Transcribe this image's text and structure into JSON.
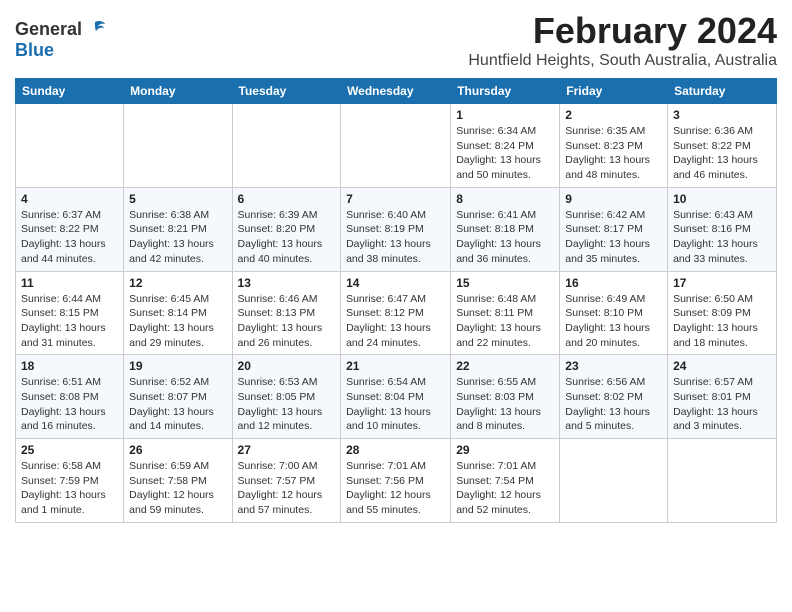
{
  "logo": {
    "general": "General",
    "blue": "Blue"
  },
  "title": {
    "month_year": "February 2024",
    "location": "Huntfield Heights, South Australia, Australia"
  },
  "weekdays": [
    "Sunday",
    "Monday",
    "Tuesday",
    "Wednesday",
    "Thursday",
    "Friday",
    "Saturday"
  ],
  "weeks": [
    [
      {
        "day": "",
        "info": ""
      },
      {
        "day": "",
        "info": ""
      },
      {
        "day": "",
        "info": ""
      },
      {
        "day": "",
        "info": ""
      },
      {
        "day": "1",
        "info": "Sunrise: 6:34 AM\nSunset: 8:24 PM\nDaylight: 13 hours\nand 50 minutes."
      },
      {
        "day": "2",
        "info": "Sunrise: 6:35 AM\nSunset: 8:23 PM\nDaylight: 13 hours\nand 48 minutes."
      },
      {
        "day": "3",
        "info": "Sunrise: 6:36 AM\nSunset: 8:22 PM\nDaylight: 13 hours\nand 46 minutes."
      }
    ],
    [
      {
        "day": "4",
        "info": "Sunrise: 6:37 AM\nSunset: 8:22 PM\nDaylight: 13 hours\nand 44 minutes."
      },
      {
        "day": "5",
        "info": "Sunrise: 6:38 AM\nSunset: 8:21 PM\nDaylight: 13 hours\nand 42 minutes."
      },
      {
        "day": "6",
        "info": "Sunrise: 6:39 AM\nSunset: 8:20 PM\nDaylight: 13 hours\nand 40 minutes."
      },
      {
        "day": "7",
        "info": "Sunrise: 6:40 AM\nSunset: 8:19 PM\nDaylight: 13 hours\nand 38 minutes."
      },
      {
        "day": "8",
        "info": "Sunrise: 6:41 AM\nSunset: 8:18 PM\nDaylight: 13 hours\nand 36 minutes."
      },
      {
        "day": "9",
        "info": "Sunrise: 6:42 AM\nSunset: 8:17 PM\nDaylight: 13 hours\nand 35 minutes."
      },
      {
        "day": "10",
        "info": "Sunrise: 6:43 AM\nSunset: 8:16 PM\nDaylight: 13 hours\nand 33 minutes."
      }
    ],
    [
      {
        "day": "11",
        "info": "Sunrise: 6:44 AM\nSunset: 8:15 PM\nDaylight: 13 hours\nand 31 minutes."
      },
      {
        "day": "12",
        "info": "Sunrise: 6:45 AM\nSunset: 8:14 PM\nDaylight: 13 hours\nand 29 minutes."
      },
      {
        "day": "13",
        "info": "Sunrise: 6:46 AM\nSunset: 8:13 PM\nDaylight: 13 hours\nand 26 minutes."
      },
      {
        "day": "14",
        "info": "Sunrise: 6:47 AM\nSunset: 8:12 PM\nDaylight: 13 hours\nand 24 minutes."
      },
      {
        "day": "15",
        "info": "Sunrise: 6:48 AM\nSunset: 8:11 PM\nDaylight: 13 hours\nand 22 minutes."
      },
      {
        "day": "16",
        "info": "Sunrise: 6:49 AM\nSunset: 8:10 PM\nDaylight: 13 hours\nand 20 minutes."
      },
      {
        "day": "17",
        "info": "Sunrise: 6:50 AM\nSunset: 8:09 PM\nDaylight: 13 hours\nand 18 minutes."
      }
    ],
    [
      {
        "day": "18",
        "info": "Sunrise: 6:51 AM\nSunset: 8:08 PM\nDaylight: 13 hours\nand 16 minutes."
      },
      {
        "day": "19",
        "info": "Sunrise: 6:52 AM\nSunset: 8:07 PM\nDaylight: 13 hours\nand 14 minutes."
      },
      {
        "day": "20",
        "info": "Sunrise: 6:53 AM\nSunset: 8:05 PM\nDaylight: 13 hours\nand 12 minutes."
      },
      {
        "day": "21",
        "info": "Sunrise: 6:54 AM\nSunset: 8:04 PM\nDaylight: 13 hours\nand 10 minutes."
      },
      {
        "day": "22",
        "info": "Sunrise: 6:55 AM\nSunset: 8:03 PM\nDaylight: 13 hours\nand 8 minutes."
      },
      {
        "day": "23",
        "info": "Sunrise: 6:56 AM\nSunset: 8:02 PM\nDaylight: 13 hours\nand 5 minutes."
      },
      {
        "day": "24",
        "info": "Sunrise: 6:57 AM\nSunset: 8:01 PM\nDaylight: 13 hours\nand 3 minutes."
      }
    ],
    [
      {
        "day": "25",
        "info": "Sunrise: 6:58 AM\nSunset: 7:59 PM\nDaylight: 13 hours\nand 1 minute."
      },
      {
        "day": "26",
        "info": "Sunrise: 6:59 AM\nSunset: 7:58 PM\nDaylight: 12 hours\nand 59 minutes."
      },
      {
        "day": "27",
        "info": "Sunrise: 7:00 AM\nSunset: 7:57 PM\nDaylight: 12 hours\nand 57 minutes."
      },
      {
        "day": "28",
        "info": "Sunrise: 7:01 AM\nSunset: 7:56 PM\nDaylight: 12 hours\nand 55 minutes."
      },
      {
        "day": "29",
        "info": "Sunrise: 7:01 AM\nSunset: 7:54 PM\nDaylight: 12 hours\nand 52 minutes."
      },
      {
        "day": "",
        "info": ""
      },
      {
        "day": "",
        "info": ""
      }
    ]
  ]
}
